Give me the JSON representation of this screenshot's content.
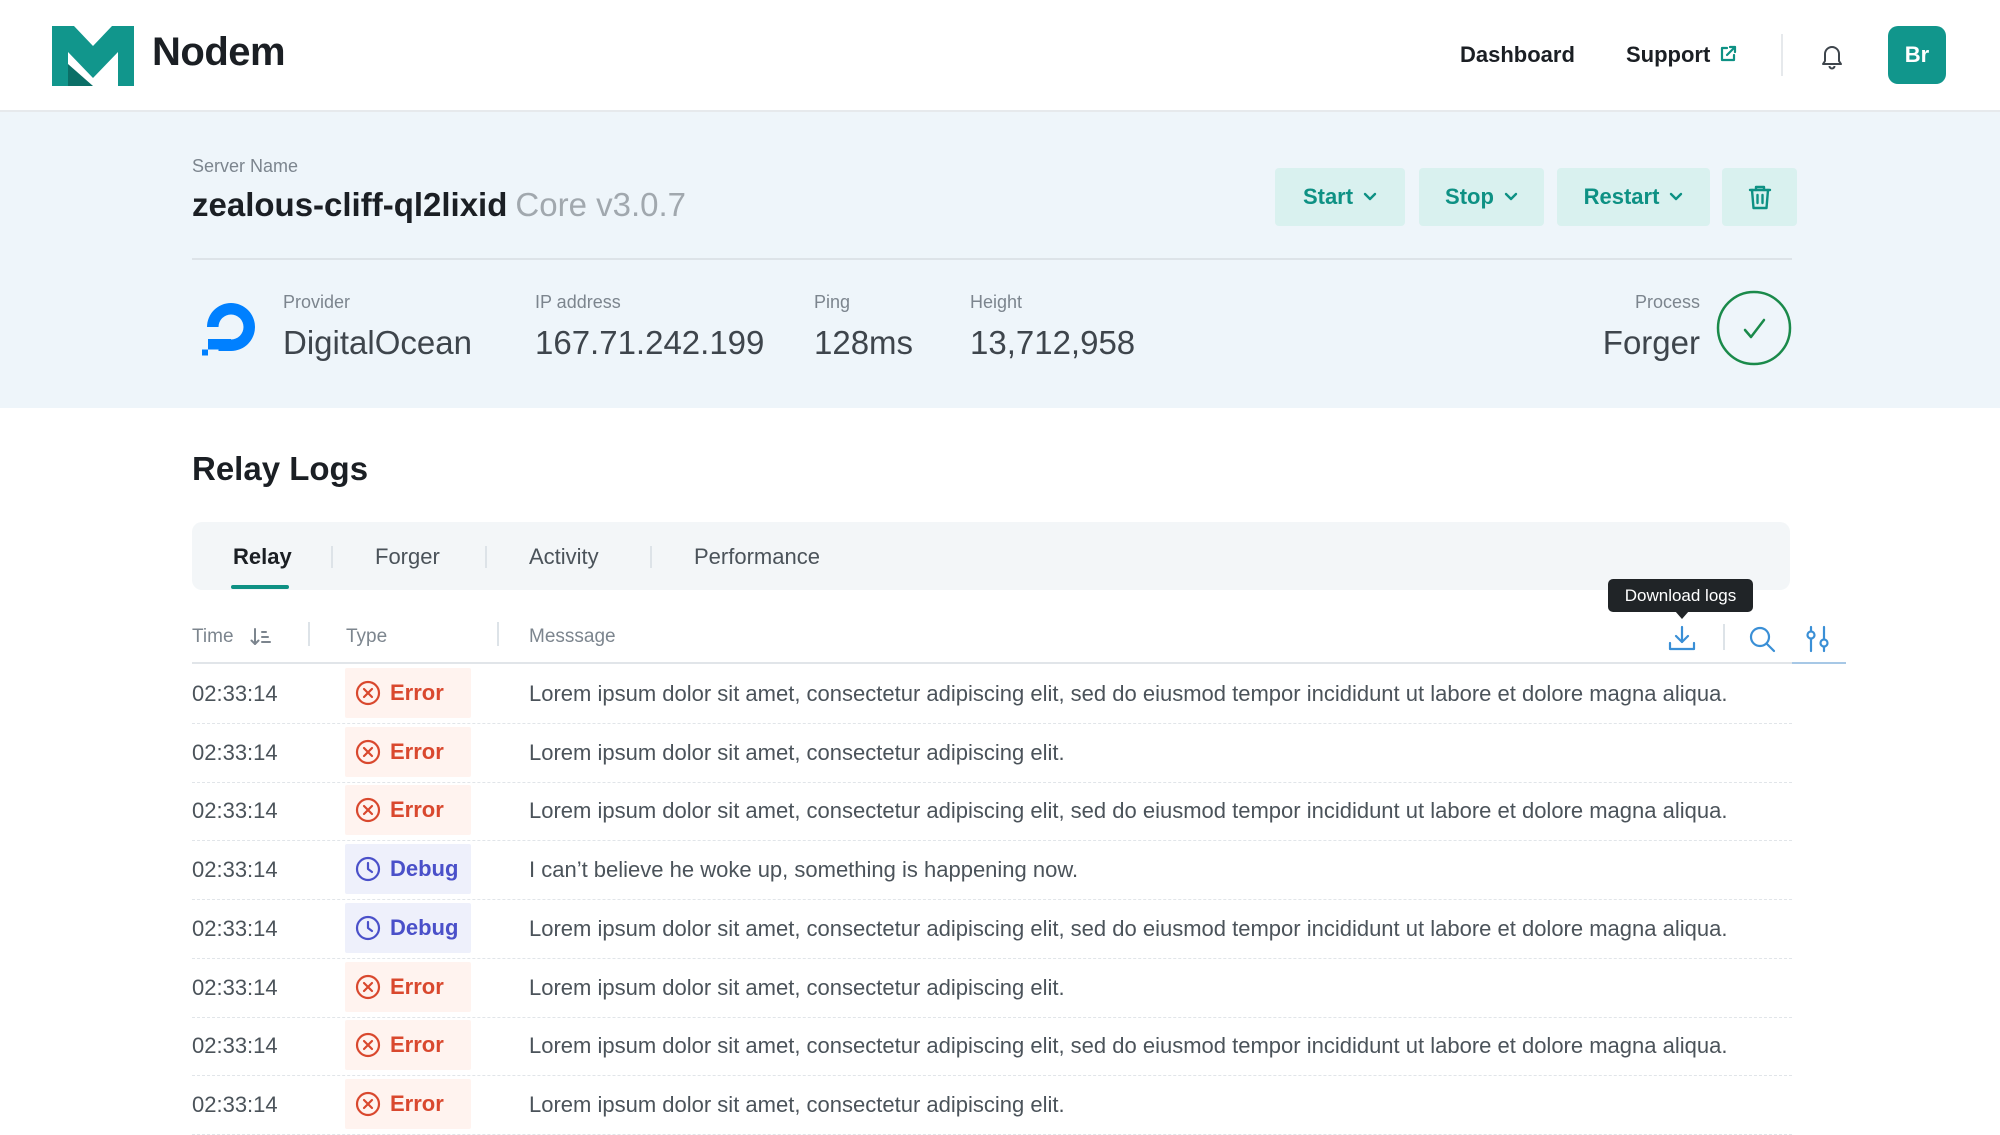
{
  "brand": {
    "name": "Nodem",
    "accent": "#11968c"
  },
  "nav": {
    "dashboard": "Dashboard",
    "support": "Support",
    "avatar_initials": "Br"
  },
  "server": {
    "label": "Server Name",
    "name": "zealous-cliff-ql2lixid",
    "version": "Core v3.0.7",
    "actions": {
      "start": "Start",
      "stop": "Stop",
      "restart": "Restart",
      "delete_icon": "trash-icon"
    }
  },
  "meta": {
    "provider_label": "Provider",
    "provider": "DigitalOcean",
    "ip_label": "IP address",
    "ip": "167.71.242.199",
    "ping_label": "Ping",
    "ping": "128ms",
    "height_label": "Height",
    "height": "13,712,958",
    "process_label": "Process",
    "process": "Forger",
    "process_status": "ok"
  },
  "logs": {
    "title": "Relay Logs",
    "tabs": [
      "Relay",
      "Forger",
      "Activity",
      "Performance"
    ],
    "active_tab": "Relay",
    "columns": {
      "time": "Time",
      "type": "Type",
      "message": "Messsage"
    },
    "tooltip": "Download logs",
    "rows": [
      {
        "time": "02:33:14",
        "type": "Error",
        "message": "Lorem ipsum dolor sit amet, consectetur adipiscing elit, sed do eiusmod tempor incididunt ut labore et dolore magna aliqua."
      },
      {
        "time": "02:33:14",
        "type": "Error",
        "message": "Lorem ipsum dolor sit amet, consectetur adipiscing elit."
      },
      {
        "time": "02:33:14",
        "type": "Error",
        "message": "Lorem ipsum dolor sit amet, consectetur adipiscing elit, sed do eiusmod tempor incididunt ut labore et dolore magna aliqua."
      },
      {
        "time": "02:33:14",
        "type": "Debug",
        "message": "I can’t believe he woke up, something is happening now."
      },
      {
        "time": "02:33:14",
        "type": "Debug",
        "message": "Lorem ipsum dolor sit amet, consectetur adipiscing elit, sed do eiusmod tempor incididunt ut labore et dolore magna aliqua."
      },
      {
        "time": "02:33:14",
        "type": "Error",
        "message": "Lorem ipsum dolor sit amet, consectetur adipiscing elit."
      },
      {
        "time": "02:33:14",
        "type": "Error",
        "message": "Lorem ipsum dolor sit amet, consectetur adipiscing elit, sed do eiusmod tempor incididunt ut labore et dolore magna aliqua."
      },
      {
        "time": "02:33:14",
        "type": "Error",
        "message": "Lorem ipsum dolor sit amet, consectetur adipiscing elit."
      }
    ]
  },
  "colors": {
    "error": "#d9482e",
    "debug": "#4a50c9",
    "panel_bg": "#eef5fa",
    "button_bg": "#d9f1ef"
  }
}
